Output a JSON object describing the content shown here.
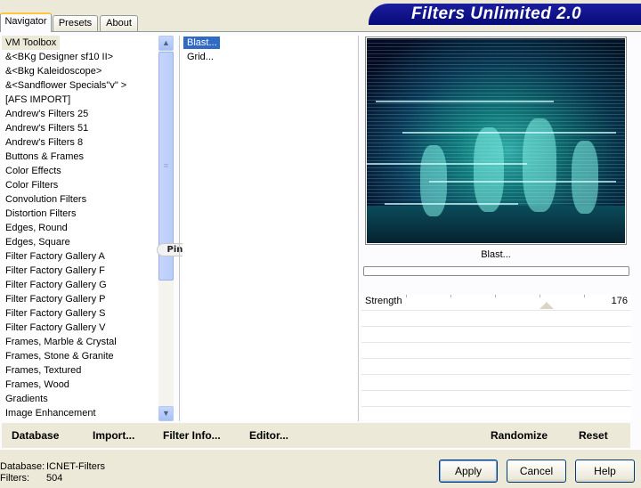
{
  "tabs": [
    "Navigator",
    "Presets",
    "About"
  ],
  "title": "Filters Unlimited 2.0",
  "categories": [
    "VM Toolbox",
    "&<BKg Designer sf10 II>",
    "&<Bkg Kaleidoscope>",
    "&<Sandflower Specials\"v\" >",
    "[AFS IMPORT]",
    "Andrew's Filters 25",
    "Andrew's Filters 51",
    "Andrew's Filters 8",
    "Buttons & Frames",
    "Color Effects",
    "Color Filters",
    "Convolution Filters",
    "Distortion Filters",
    "Edges, Round",
    "Edges, Square",
    "Filter Factory Gallery A",
    "Filter Factory Gallery F",
    "Filter Factory Gallery G",
    "Filter Factory Gallery P",
    "Filter Factory Gallery S",
    "Filter Factory Gallery V",
    "Frames, Marble & Crystal",
    "Frames, Stone & Granite",
    "Frames, Textured",
    "Frames, Wood",
    "Gradients",
    "Image Enhancement"
  ],
  "selected_category": "VM Toolbox",
  "effects": [
    "Blast...",
    "Grid..."
  ],
  "selected_effect": "Blast...",
  "watermark": "Pinuccia",
  "preview_caption": "Blast...",
  "parameter": {
    "label": "Strength",
    "value": "176"
  },
  "commands": {
    "database": "Database",
    "import": "Import...",
    "filter_info": "Filter Info...",
    "editor": "Editor...",
    "randomize": "Randomize",
    "reset": "Reset"
  },
  "status": {
    "database_label": "Database:",
    "database_value": "ICNET-Filters",
    "filters_label": "Filters:",
    "filters_value": "504"
  },
  "buttons": {
    "apply": "Apply",
    "cancel": "Cancel",
    "help": "Help"
  },
  "colors": {
    "banner": "#0a0f86",
    "selection": "#316ac5",
    "tab_highlight": "#ffc83c"
  }
}
